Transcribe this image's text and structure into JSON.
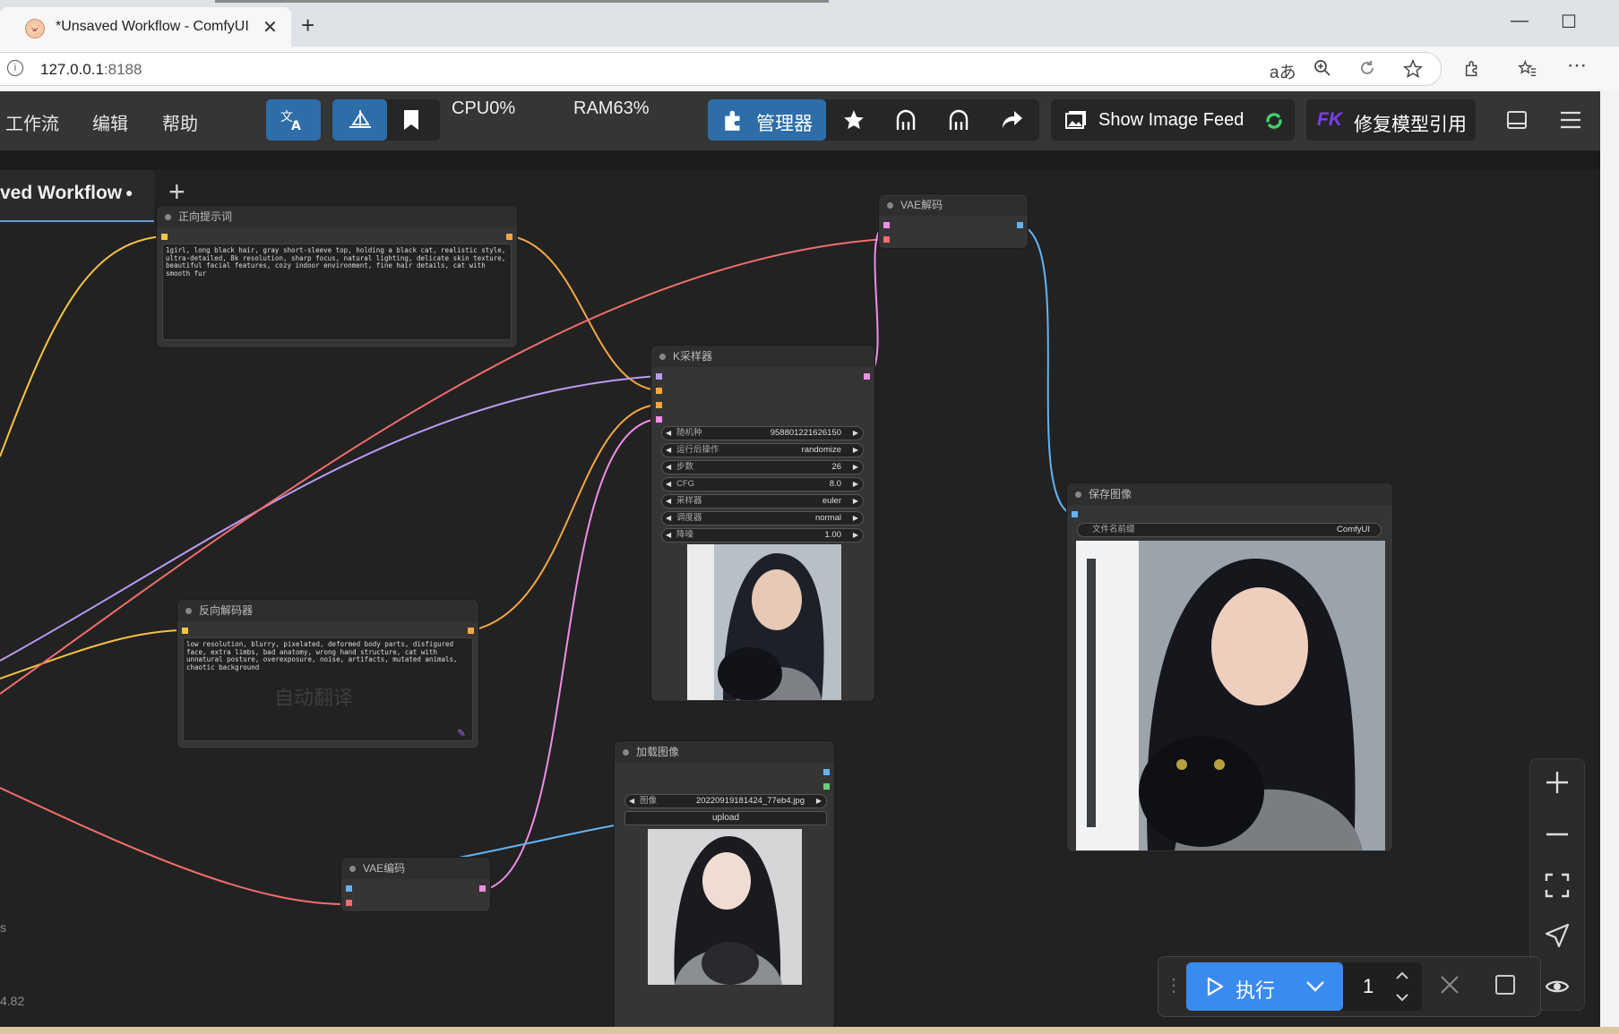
{
  "browser": {
    "tab_title": "*Unsaved Workflow - ComfyUI",
    "tab_close": "✕",
    "new_tab": "+",
    "url_host": "127.0.0.1",
    "url_port": ":8188",
    "window_controls": [
      "—",
      "☐",
      "✕"
    ],
    "read_aloud": "aあ"
  },
  "menu": {
    "items": [
      "工作流",
      "编辑",
      "帮助"
    ],
    "cpu": "CPU0%",
    "ram": "RAM63%",
    "manager": "管理器",
    "show_image_feed": "Show Image Feed",
    "fk_badge": "FK",
    "fix_model": "修复模型引用"
  },
  "workflow_tab": {
    "name": "ved Workflow",
    "dot": "●",
    "add": "+"
  },
  "nodes": {
    "positive": {
      "title": "正向提示词",
      "text": "1girl, long black hair, gray short-sleeve top, holding a black cat, realistic style, ultra-detailed, 8k resolution, sharp focus, natural lighting, delicate skin texture, beautiful facial features, cozy indoor environment, fine hair details, cat with smooth fur"
    },
    "negative": {
      "title": "反向解码器",
      "text": "low resolution, blurry, pixelated, deformed body parts, disfigured face, extra limbs, bad anatomy, wrong hand structure, cat with unnatural posture, overexposure, noise, artifacts, mutated animals, chaotic background",
      "watermark": "自动翻译"
    },
    "ksampler": {
      "title": "K采样器",
      "widgets": [
        {
          "label": "随机种",
          "value": "958801221626150"
        },
        {
          "label": "运行后操作",
          "value": "randomize"
        },
        {
          "label": "步数",
          "value": "26"
        },
        {
          "label": "CFG",
          "value": "8.0"
        },
        {
          "label": "采样器",
          "value": "euler"
        },
        {
          "label": "调度器",
          "value": "normal"
        },
        {
          "label": "降噪",
          "value": "1.00"
        }
      ]
    },
    "vae_decode": {
      "title": "VAE解码"
    },
    "vae_encode": {
      "title": "VAE编码"
    },
    "save_image": {
      "title": "保存图像",
      "prefix_label": "文件名前缀",
      "prefix_value": "ComfyUI"
    },
    "load_image": {
      "title": "加载图像",
      "image_label": "图像",
      "image_value": "20220919181424_77eb4.jpg",
      "upload": "upload"
    }
  },
  "canvas_left_text": {
    "s": "s",
    "version": "4.82"
  },
  "runbar": {
    "run_label": "执行",
    "count": "1"
  },
  "colors": {
    "clip_yellow": "#f6c342",
    "cond_orange": "#f5a742",
    "latent_pink": "#f08ee8",
    "vae_red": "#f26d6d",
    "model_purple": "#b89bf2",
    "image_blue": "#63b3f2",
    "accent_blue": "#2d6da8"
  }
}
